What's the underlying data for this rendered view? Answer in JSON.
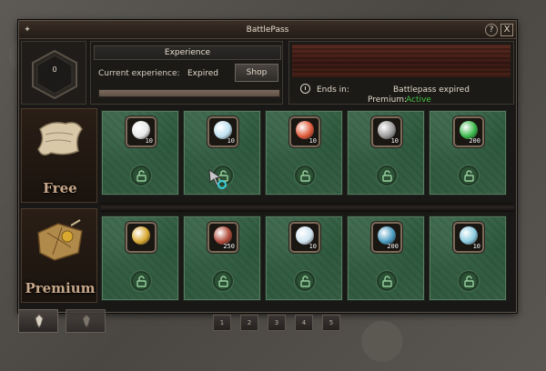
{
  "window": {
    "title": "BattlePass",
    "help_label": "?",
    "close_label": "X"
  },
  "level": {
    "value": "0"
  },
  "experience": {
    "title": "Experience",
    "current_label": "Current experience:",
    "current_value": "Expired",
    "shop_label": "Shop",
    "progress_fraction": 0
  },
  "season": {
    "ends_label": "Ends in:",
    "ends_value": "Battlepass expired",
    "premium_label": "Premium:",
    "premium_value": "Active",
    "premium_color": "#46c046"
  },
  "tiers": {
    "free_label": "Free",
    "premium_label": "Premium"
  },
  "rewards": {
    "free": [
      {
        "icon": "white-gem-icon",
        "qty": "10",
        "color": "#e8e8e8"
      },
      {
        "icon": "blue-white-gem-icon",
        "qty": "10",
        "color": "#bfe0f0"
      },
      {
        "icon": "red-gem-icon",
        "qty": "10",
        "color": "#e05a3a"
      },
      {
        "icon": "armor-icon",
        "qty": "10",
        "color": "#9a9a9a"
      },
      {
        "icon": "green-crystal-icon",
        "qty": "200",
        "color": "#3ab84a"
      }
    ],
    "premium": [
      {
        "icon": "gold-treasure-icon",
        "qty": "",
        "color": "#d8a830"
      },
      {
        "icon": "ticket-scroll-icon",
        "qty": "250",
        "color": "#b04a3a"
      },
      {
        "icon": "diamond-crystal-icon",
        "qty": "10",
        "color": "#cfe4f0"
      },
      {
        "icon": "blue-ore-icon",
        "qty": "200",
        "color": "#4a9ac0"
      },
      {
        "icon": "ice-crystal-icon",
        "qty": "10",
        "color": "#8acbe0"
      }
    ]
  },
  "pager": {
    "pages": [
      "1",
      "2",
      "3",
      "4",
      "5"
    ]
  }
}
